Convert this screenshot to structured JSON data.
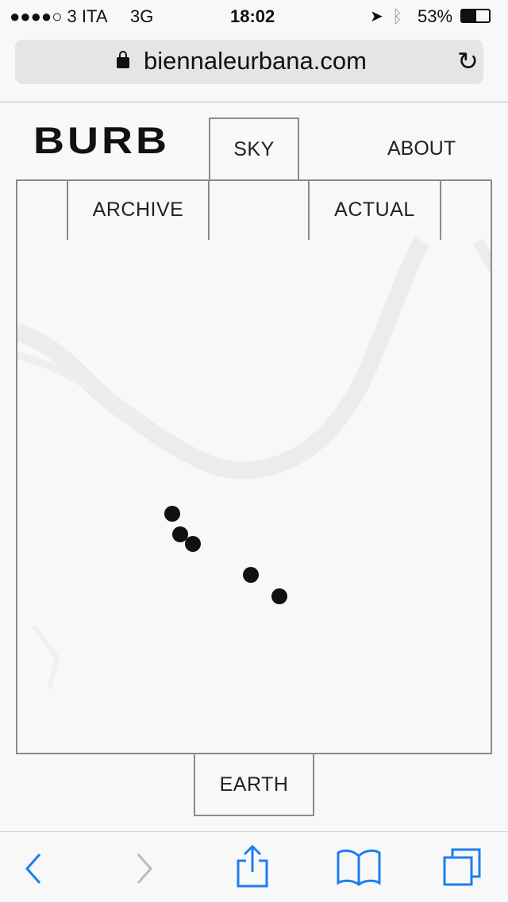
{
  "status_bar": {
    "carrier": "●●●●○ 3 ITA",
    "network": "3G",
    "time": "18:02",
    "battery": "53%",
    "battery_level": 53
  },
  "browser": {
    "url": "biennaleurbana.com",
    "icons": [
      "lock-icon",
      "reload-icon"
    ]
  },
  "site": {
    "logo": "BURB",
    "nav": {
      "sky": "SKY",
      "about": "ABOUT",
      "archive": "ARCHIVE",
      "actual": "ACTUAL",
      "earth": "EARTH"
    }
  },
  "map": {
    "markers": 5
  },
  "toolbar": {
    "icons": [
      "back-icon",
      "forward-icon",
      "share-icon",
      "bookmarks-icon",
      "tabs-icon"
    ],
    "accent": "#1a7ef2"
  }
}
